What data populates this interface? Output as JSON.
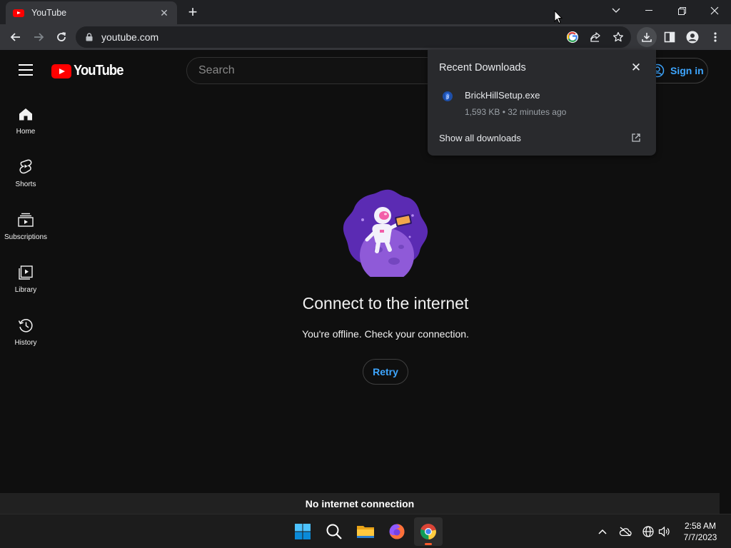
{
  "browser": {
    "tab_title": "YouTube",
    "url": "youtube.com"
  },
  "youtube": {
    "logo_text": "YouTube",
    "search_placeholder": "Search",
    "sign_in_label": "Sign in",
    "nav": [
      {
        "label": "Home",
        "icon": "home-icon"
      },
      {
        "label": "Shorts",
        "icon": "shorts-icon"
      },
      {
        "label": "Subscriptions",
        "icon": "subscriptions-icon"
      },
      {
        "label": "Library",
        "icon": "library-icon"
      },
      {
        "label": "History",
        "icon": "history-icon"
      }
    ],
    "offline": {
      "title": "Connect to the internet",
      "message": "You're offline. Check your connection.",
      "retry_label": "Retry"
    },
    "status_bar": "No internet connection"
  },
  "downloads": {
    "title": "Recent Downloads",
    "file_name": "BrickHillSetup.exe",
    "file_meta": "1,593 KB • 32 minutes ago",
    "show_all_label": "Show all downloads"
  },
  "taskbar": {
    "time": "2:58 AM",
    "date": "7/7/2023"
  },
  "colors": {
    "youtube_red": "#ff0000",
    "link_blue": "#3ea6ff",
    "page_bg": "#0f0f0f",
    "chrome_toolbar": "#35363a"
  }
}
